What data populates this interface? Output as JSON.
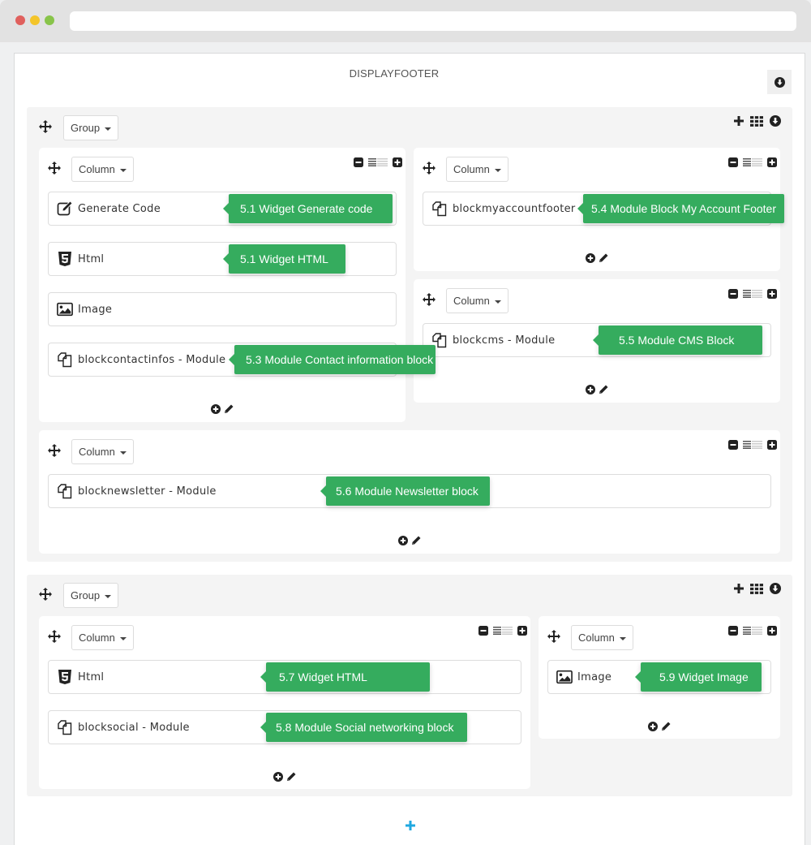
{
  "window": {
    "traffic_lights": [
      "close",
      "minimize",
      "maximize"
    ]
  },
  "hook": {
    "title": "DISPLAYFOOTER",
    "toggle_icon": "arrow-circle-down-icon"
  },
  "groups": [
    {
      "label": "Group",
      "tools": [
        "plus-icon",
        "grid-icon",
        "arrow-circle-down-icon"
      ],
      "columns": [
        {
          "label": "Column",
          "widgets": [
            {
              "icon": "edit-icon",
              "name": "Generate Code",
              "tip": "5.1 Widget Generate code"
            },
            {
              "icon": "html5-icon",
              "name": "Html",
              "tip": "5.1 Widget HTML"
            },
            {
              "icon": "image-icon",
              "name": "Image",
              "tip": ""
            },
            {
              "icon": "module-icon",
              "name": "blockcontactinfos - Module",
              "tip": "5.3 Module Contact information block"
            }
          ]
        },
        {
          "label": "Column",
          "widgets": [
            {
              "icon": "module-icon",
              "name": "blockmyaccountfooter - Module",
              "tip": "5.4 Module Block My Account Footer"
            }
          ]
        },
        {
          "label": "Column",
          "widgets": [
            {
              "icon": "module-icon",
              "name": "blockcms - Module",
              "tip": "5.5 Module CMS Block"
            }
          ]
        },
        {
          "label": "Column",
          "widgets": [
            {
              "icon": "module-icon",
              "name": "blocknewsletter - Module",
              "tip": "5.6 Module Newsletter block"
            }
          ]
        }
      ]
    },
    {
      "label": "Group",
      "tools": [
        "plus-icon",
        "grid-icon",
        "arrow-circle-down-icon"
      ],
      "columns": [
        {
          "label": "Column",
          "widgets": [
            {
              "icon": "html5-icon",
              "name": "Html",
              "tip": "5.7 Widget HTML"
            },
            {
              "icon": "module-icon",
              "name": "blocksocial - Module",
              "tip": "5.8 Module Social networking block"
            }
          ]
        },
        {
          "label": "Column",
          "widgets": [
            {
              "icon": "image-icon",
              "name": "Image",
              "tip": "5.9 Widget Image"
            }
          ]
        }
      ]
    }
  ],
  "colors": {
    "tip_green": "#35ac5e",
    "add_blue": "#1fa8e0",
    "group_bg": "#f4f4f4"
  }
}
